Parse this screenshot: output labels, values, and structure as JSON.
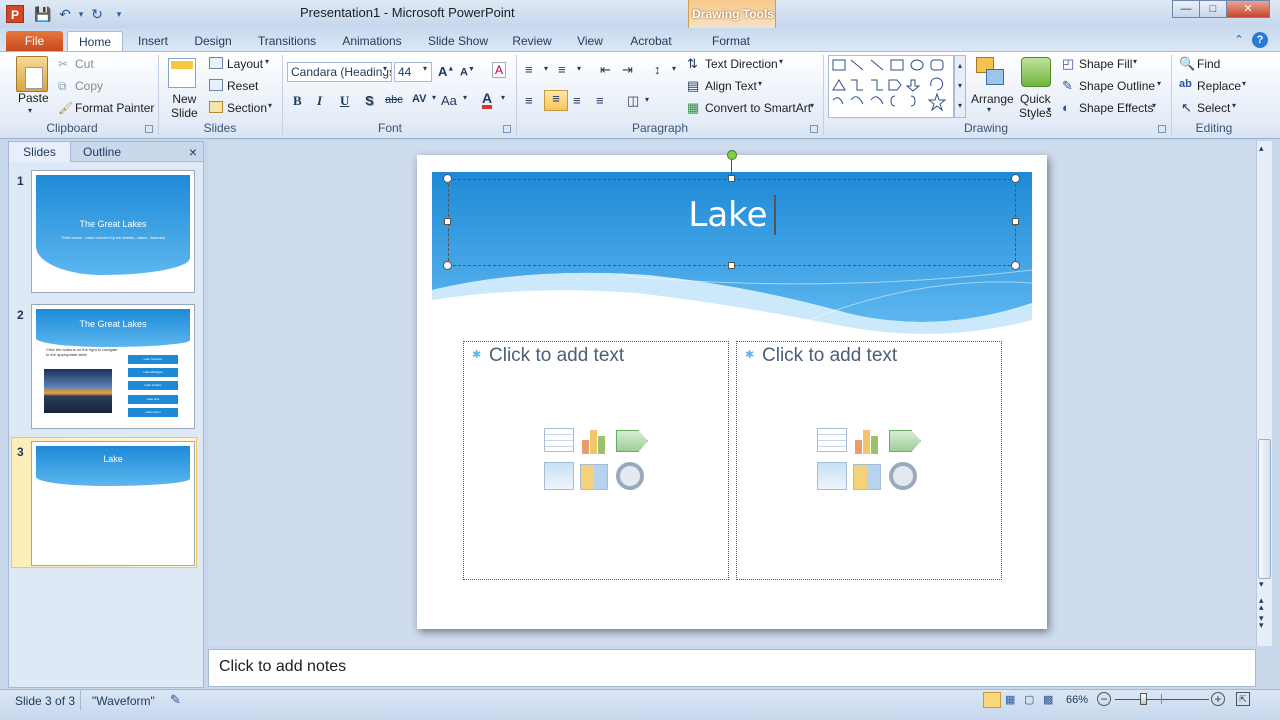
{
  "window": {
    "title": "Presentation1  -  Microsoft PowerPoint",
    "context_tab_group": "Drawing Tools",
    "app_icon": "P"
  },
  "tabs": [
    "File",
    "Home",
    "Insert",
    "Design",
    "Transitions",
    "Animations",
    "Slide Show",
    "Review",
    "View",
    "Acrobat",
    "Format"
  ],
  "ribbon": {
    "clipboard": {
      "paste": "Paste",
      "cut": "Cut",
      "copy": "Copy",
      "format_painter": "Format Painter",
      "label": "Clipboard"
    },
    "slides": {
      "new_slide": "New\nSlide",
      "layout": "Layout",
      "reset": "Reset",
      "section": "Section",
      "label": "Slides"
    },
    "font": {
      "font_name": "Candara (Headings)",
      "font_size": "44",
      "label": "Font",
      "bold": "B",
      "italic": "I",
      "underline": "U",
      "shadow": "S",
      "strike": "abc",
      "spacing": "AV",
      "case": "Aa",
      "color": "A"
    },
    "paragraph": {
      "text_direction": "Text Direction",
      "align_text": "Align Text",
      "convert_smartart": "Convert to SmartArt",
      "label": "Paragraph"
    },
    "drawing": {
      "arrange": "Arrange",
      "quick_styles": "Quick\nStyles",
      "shape_fill": "Shape Fill",
      "shape_outline": "Shape Outline",
      "shape_effects": "Shape Effects",
      "label": "Drawing"
    },
    "editing": {
      "find": "Find",
      "replace": "Replace",
      "select": "Select",
      "label": "Editing"
    }
  },
  "panel": {
    "tabs": [
      "Slides",
      "Outline"
    ],
    "close": "×",
    "thumbnails": [
      {
        "num": "1",
        "title": "The Great Lakes",
        "subtitle": "Their cause - once covered by ice sheets - lakes - America"
      },
      {
        "num": "2",
        "title": "The Great Lakes",
        "body": "Click the buttons on the right to navigate to the appropriate slide",
        "buttons": [
          "Lake Superior",
          "Lake Michigan",
          "Lake Ontario",
          "Lake Erie",
          "Lake Huron"
        ]
      },
      {
        "num": "3",
        "title": "Lake",
        "selected": true
      }
    ]
  },
  "slide": {
    "title": "Lake",
    "left_placeholder": "Click to add text",
    "right_placeholder": "Click to add text"
  },
  "notes": {
    "placeholder": "Click to add notes"
  },
  "status": {
    "slide_info": "Slide 3 of 3",
    "theme": "\"Waveform\"",
    "zoom": "66%",
    "zoom_level": 0.66
  },
  "colors": {
    "accent": "#2b579a",
    "file_tab": "#d24726",
    "banner_top": "#1e8ad6",
    "banner_bottom": "#5cb6ef",
    "title_text": "#ffffff"
  }
}
